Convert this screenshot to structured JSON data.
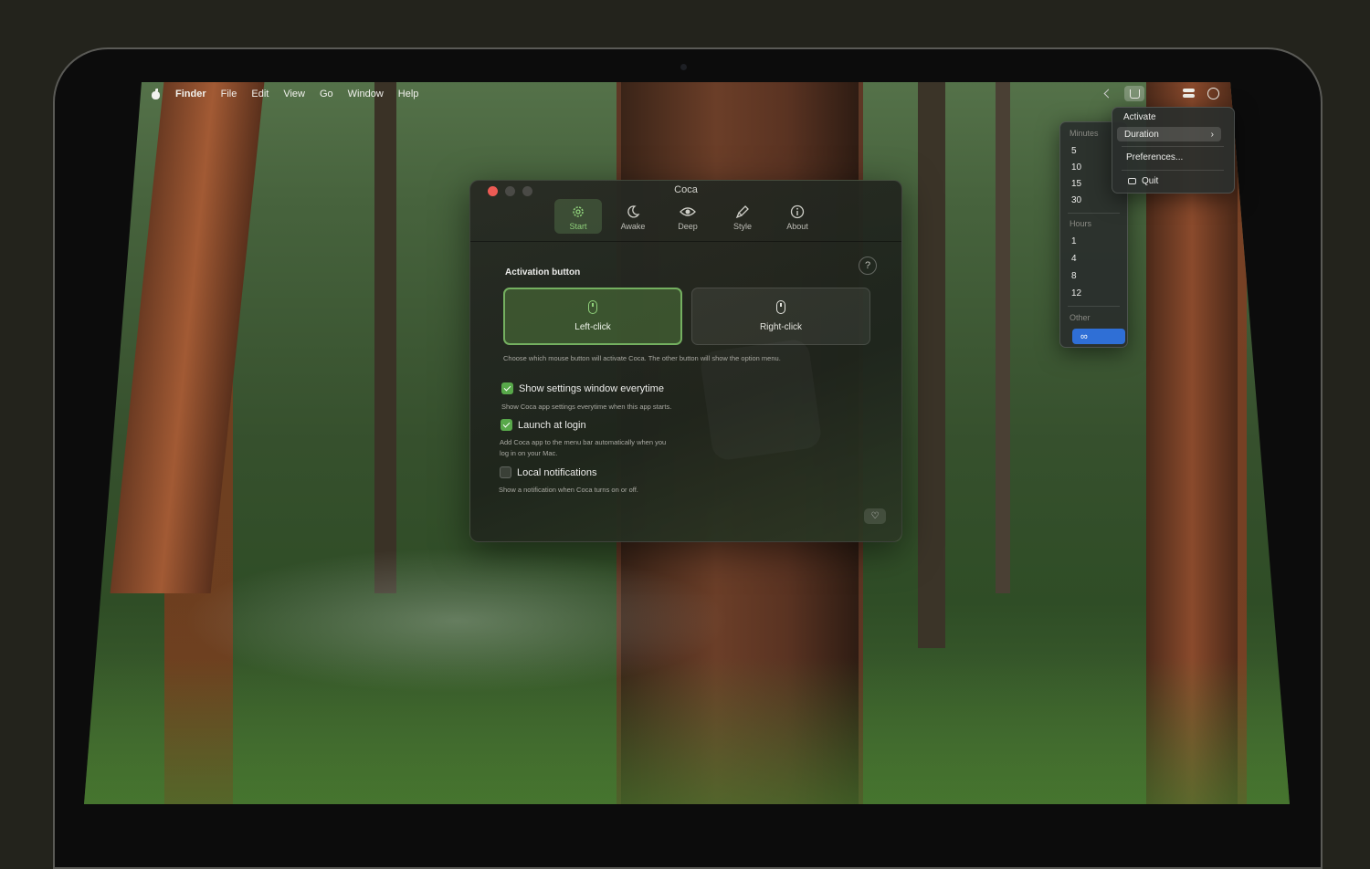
{
  "menubar": {
    "app_name": "Finder",
    "items": [
      "File",
      "Edit",
      "View",
      "Go",
      "Window",
      "Help"
    ]
  },
  "window": {
    "title": "Coca",
    "tabs": [
      {
        "label": "Start",
        "icon": "gear-icon",
        "selected": true
      },
      {
        "label": "Awake",
        "icon": "moon-icon",
        "selected": false
      },
      {
        "label": "Deep",
        "icon": "eye-icon",
        "selected": false
      },
      {
        "label": "Style",
        "icon": "paintbrush-icon",
        "selected": false
      },
      {
        "label": "About",
        "icon": "info-icon",
        "selected": false
      }
    ],
    "help_label": "?",
    "activation_title": "Activation button",
    "left_click_label": "Left-click",
    "right_click_label": "Right-click",
    "activation_desc": "Choose which mouse button will activate Coca. The other button will show the option menu.",
    "options": [
      {
        "label": "Show settings window everytime",
        "checked": true,
        "desc": "Show Coca app settings everytime when this app starts."
      },
      {
        "label": "Launch at login",
        "checked": true,
        "desc": "Add Coca app to the menu bar automatically when you log in on your Mac."
      },
      {
        "label": "Local notifications",
        "checked": false,
        "desc": "Show a notification when Coca turns on or off."
      }
    ],
    "heart_label": "♡"
  },
  "main_menu": {
    "activate": "Activate",
    "duration": "Duration",
    "preferences": "Preferences...",
    "quit": "Quit"
  },
  "duration_menu": {
    "minutes_header": "Minutes",
    "minutes": [
      "5",
      "10",
      "15",
      "30"
    ],
    "hours_header": "Hours",
    "hours": [
      "1",
      "4",
      "8",
      "12"
    ],
    "other_header": "Other",
    "selected": "∞"
  },
  "colors": {
    "accent_green": "#58a84a",
    "selection_blue": "#2f6fd6",
    "close_red": "#ed5b54"
  }
}
